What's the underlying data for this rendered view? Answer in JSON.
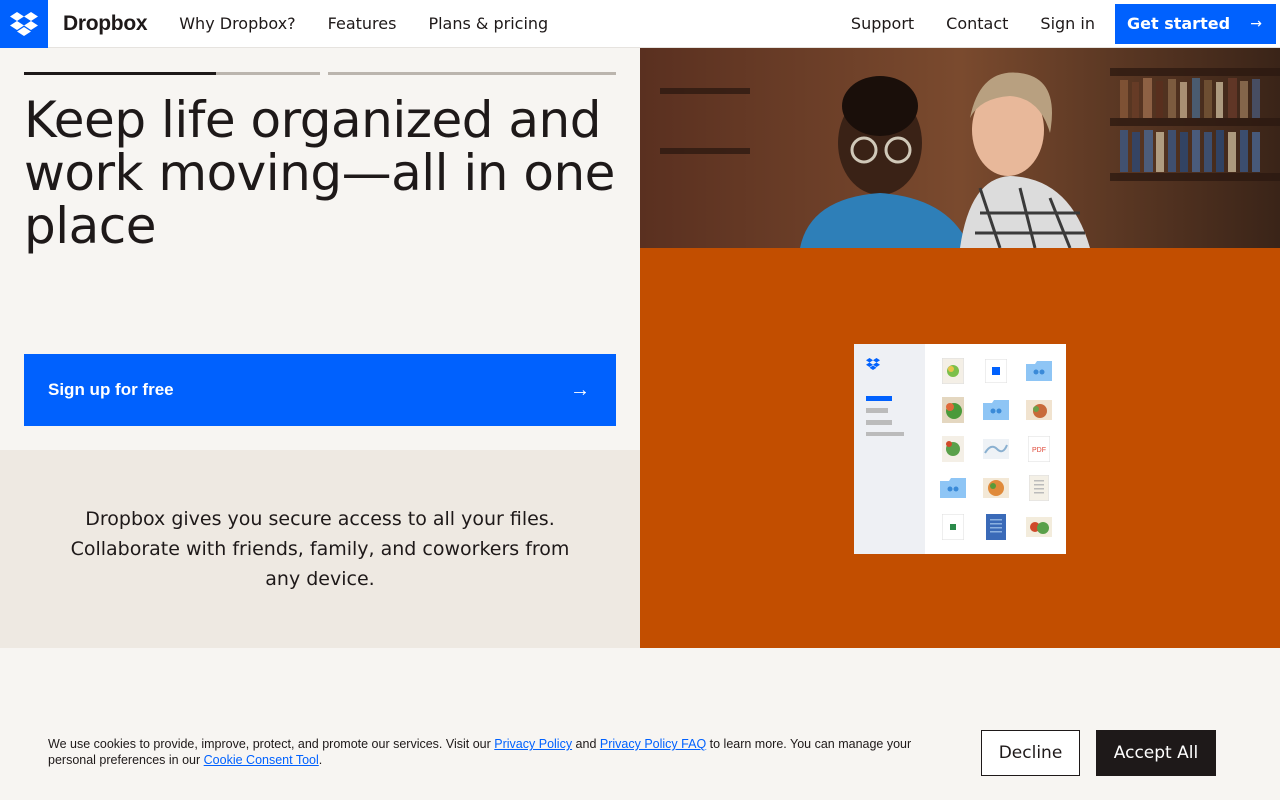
{
  "header": {
    "brand": "Dropbox",
    "nav_left": [
      "Why Dropbox?",
      "Features",
      "Plans & pricing"
    ],
    "nav_right": [
      "Support",
      "Contact",
      "Sign in"
    ],
    "cta_label": "Get started",
    "cta_icon": "arrow-right-icon"
  },
  "hero": {
    "carousel": {
      "slides": 2,
      "active": 1,
      "active_progress": 0.65
    },
    "headline": "Keep life organized and work moving—all in one place",
    "signup_label": "Sign up for free",
    "signup_icon": "arrow-right-icon",
    "description": "Dropbox gives you secure access to all your files. Collaborate with friends, family, and coworkers from any device."
  },
  "cookie_banner": {
    "text_1": "We use cookies to provide, improve, protect, and promote our services. Visit our ",
    "link_1": "Privacy Policy",
    "text_2": " and ",
    "link_2": "Privacy Policy FAQ",
    "text_3": " to learn more. You can manage your personal preferences in our ",
    "link_3": "Cookie Consent Tool",
    "text_4": ".",
    "decline_label": "Decline",
    "accept_label": "Accept All"
  },
  "colors": {
    "brand_blue": "#0061fe",
    "accent_orange": "#c24e00",
    "text_dark": "#1e1919",
    "bg_cream": "#f7f5f2",
    "bg_panel": "#eee9e2"
  }
}
